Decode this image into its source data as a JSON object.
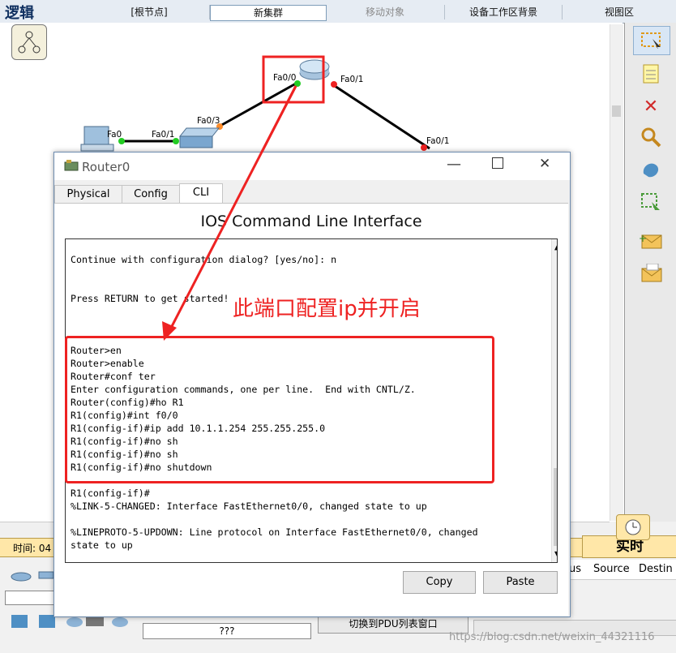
{
  "toolbar": {
    "logic": "逻辑",
    "root": "[根节点]",
    "new_cluster": "新集群",
    "move_object": "移动对象",
    "device_bg": "设备工作区背景",
    "viewport": "视图区"
  },
  "topology": {
    "ports": {
      "router_fa00": "Fa0/0",
      "router_fa01": "Fa0/1",
      "switch_fa03": "Fa0/3",
      "switch_fa01": "Fa0/1",
      "pc_fa0": "Fa0",
      "right_fa01": "Fa0/1"
    },
    "annotation": "此端口配置ip并开启"
  },
  "dialog": {
    "title": "Router0",
    "tabs": [
      "Physical",
      "Config",
      "CLI"
    ],
    "active_tab": "CLI",
    "heading": "IOS Command Line Interface",
    "copy_label": "Copy",
    "paste_label": "Paste"
  },
  "terminal": {
    "lines": [
      "Continue with configuration dialog? [yes/no]: n",
      "",
      "",
      "Press RETURN to get started!",
      "",
      "",
      "",
      "Router>en",
      "Router>enable",
      "Router#conf ter",
      "Enter configuration commands, one per line.  End with CNTL/Z.",
      "Router(config)#ho R1",
      "R1(config)#int f0/0",
      "R1(config-if)#ip add 10.1.1.254 255.255.255.0",
      "R1(config-if)#no sh",
      "R1(config-if)#no sh",
      "R1(config-if)#no shutdown",
      "",
      "",
      "R1(config-if)#",
      "%LINK-5-CHANGED: Interface FastEthernet0/0, changed state to up",
      "",
      "%LINEPROTO-5-UPDOWN: Line protocol on Interface FastEthernet0/0, changed",
      "state to up"
    ]
  },
  "bottom": {
    "time_label": "时间: 04",
    "realtime": "实时",
    "pdu_switch": "切换到PDU列表窗口",
    "unknown": "???",
    "columns": [
      "us",
      "Source",
      "Destin"
    ],
    "watermark": "https://blog.csdn.net/weixin_44321116"
  },
  "colors": {
    "accent_red": "#ee2222",
    "link_up": "#22cc22",
    "link_down": "#ff6a00",
    "realtime_bg": "#ffe7a8"
  }
}
